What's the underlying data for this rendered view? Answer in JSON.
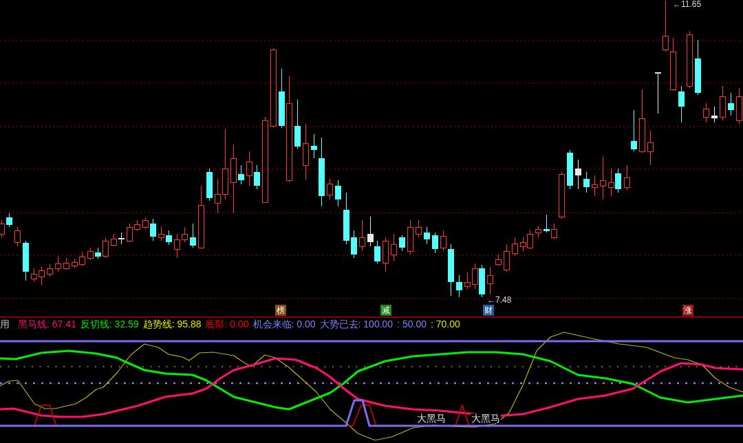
{
  "price_chart": {
    "price_labels": [
      {
        "text": "←11.65"
      },
      {
        "text": "←7.48"
      }
    ],
    "event_markers": [
      {
        "text": "榜",
        "color": "#8b4a12"
      },
      {
        "text": "减",
        "color": "#1c8a1c"
      },
      {
        "text": "财",
        "color": "#1f5f9e"
      },
      {
        "text": "涨",
        "color": "#a01818"
      }
    ]
  },
  "indicator_legend": {
    "prefix": "用",
    "items": [
      {
        "text": "黑马线: 67.41",
        "color": "#ff0a78"
      },
      {
        "text": "反切线: 32.59",
        "color": "#00e600"
      },
      {
        "text": "趋势线: 95.88",
        "color": "#e6e600"
      },
      {
        "text": "底部: 0.00",
        "color": "#ff0000"
      },
      {
        "text": "机会来临: 0.00",
        "color": "#8080ff"
      },
      {
        "text": "大势已去: 100.00",
        "color": "#8080ff"
      },
      {
        "text": ": 50.00",
        "color": "#8080ff"
      },
      {
        "text": ": 70.00",
        "color": "#e6e600"
      }
    ]
  },
  "indicator_panel": {
    "signal_labels": [
      {
        "text": "大黑马"
      },
      {
        "text": "大黑马"
      }
    ]
  }
}
